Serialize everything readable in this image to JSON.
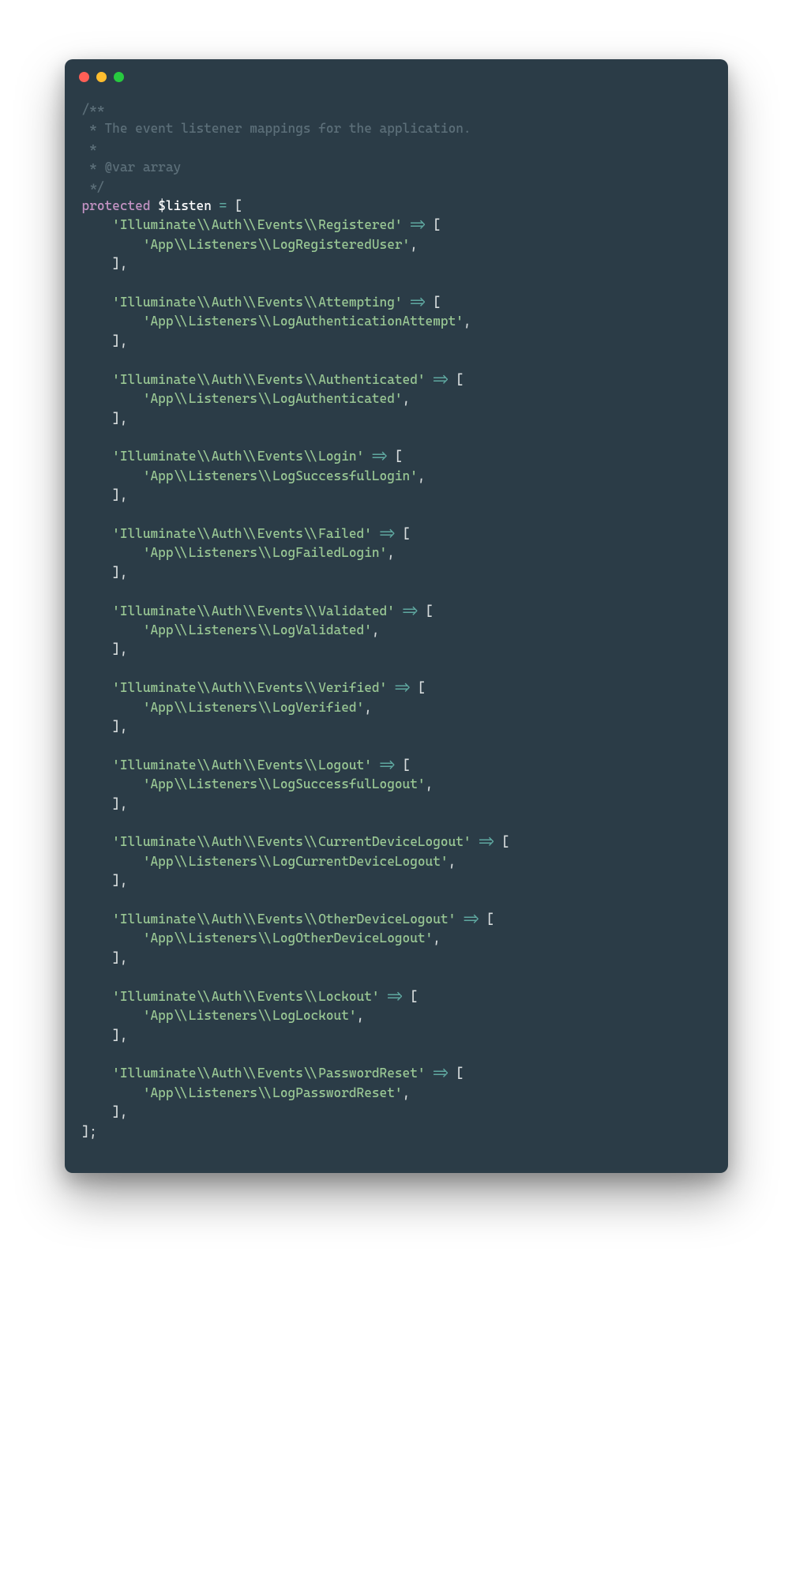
{
  "comment": {
    "l1": "/**",
    "l2": " * The event listener mappings for the application.",
    "l3": " *",
    "l4": " * @var array",
    "l5": " */"
  },
  "tokens": {
    "protected": "protected",
    "listenVar": "$listen",
    "assign": "=",
    "arrow": "=>",
    "openBr": "[",
    "closeBr": "]",
    "closeBrComma": "],",
    "closeBrSemi": "];",
    "comma": ","
  },
  "groups": [
    {
      "event": "'Illuminate\\\\Auth\\\\Events\\\\Registered'",
      "listener": "'App\\\\Listeners\\\\LogRegisteredUser'"
    },
    {
      "event": "'Illuminate\\\\Auth\\\\Events\\\\Attempting'",
      "listener": "'App\\\\Listeners\\\\LogAuthenticationAttempt'"
    },
    {
      "event": "'Illuminate\\\\Auth\\\\Events\\\\Authenticated'",
      "listener": "'App\\\\Listeners\\\\LogAuthenticated'"
    },
    {
      "event": "'Illuminate\\\\Auth\\\\Events\\\\Login'",
      "listener": "'App\\\\Listeners\\\\LogSuccessfulLogin'"
    },
    {
      "event": "'Illuminate\\\\Auth\\\\Events\\\\Failed'",
      "listener": "'App\\\\Listeners\\\\LogFailedLogin'"
    },
    {
      "event": "'Illuminate\\\\Auth\\\\Events\\\\Validated'",
      "listener": "'App\\\\Listeners\\\\LogValidated'"
    },
    {
      "event": "'Illuminate\\\\Auth\\\\Events\\\\Verified'",
      "listener": "'App\\\\Listeners\\\\LogVerified'"
    },
    {
      "event": "'Illuminate\\\\Auth\\\\Events\\\\Logout'",
      "listener": "'App\\\\Listeners\\\\LogSuccessfulLogout'"
    },
    {
      "event": "'Illuminate\\\\Auth\\\\Events\\\\CurrentDeviceLogout'",
      "listener": "'App\\\\Listeners\\\\LogCurrentDeviceLogout'"
    },
    {
      "event": "'Illuminate\\\\Auth\\\\Events\\\\OtherDeviceLogout'",
      "listener": "'App\\\\Listeners\\\\LogOtherDeviceLogout'"
    },
    {
      "event": "'Illuminate\\\\Auth\\\\Events\\\\Lockout'",
      "listener": "'App\\\\Listeners\\\\LogLockout'"
    },
    {
      "event": "'Illuminate\\\\Auth\\\\Events\\\\PasswordReset'",
      "listener": "'App\\\\Listeners\\\\LogPasswordReset'"
    }
  ]
}
